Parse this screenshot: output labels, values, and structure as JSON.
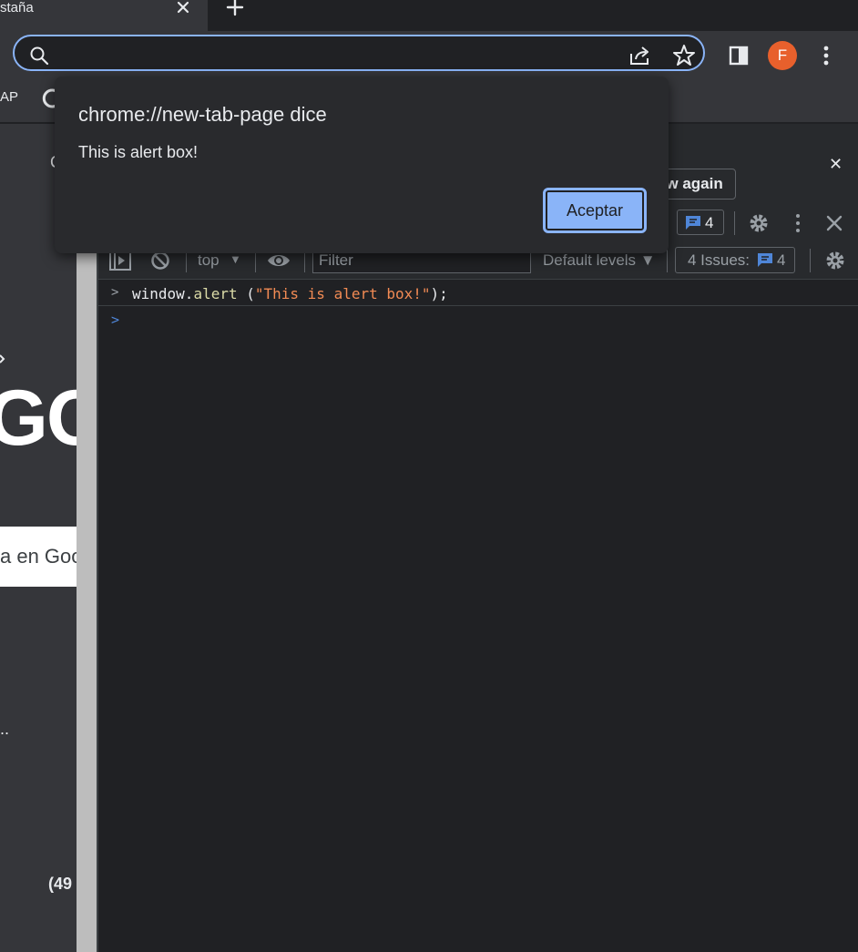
{
  "tab": {
    "title": "staña",
    "close": "✕",
    "new_tab": "+"
  },
  "profile": {
    "initial": "F"
  },
  "bookmarks": {
    "label": "AP"
  },
  "page": {
    "c_fragment": "C",
    "logo_fragment": "GO",
    "search_fragment": "a en Goo",
    "dots_fragment": "..",
    "count_fragment": "(49"
  },
  "devtools": {
    "show_again": "ow again",
    "info_close": "✕",
    "messages_count": "4",
    "context": "top",
    "filter_placeholder": "Filter",
    "levels": "Default levels ▼",
    "issues_label": "4 Issues:",
    "issues_count": "4"
  },
  "console": {
    "command_plain1": "window.",
    "command_fn": "alert",
    "command_plain2": " (",
    "command_str": "\"This is alert box!\"",
    "command_plain3": ");"
  },
  "alert": {
    "title": "chrome://new-tab-page dice",
    "message": "This is alert box!",
    "ok_label": "Aceptar"
  },
  "colors": {
    "accent": "#8ab4f8",
    "avatar": "#e8602c",
    "string": "#f28b54",
    "function": "#dcdca8"
  }
}
